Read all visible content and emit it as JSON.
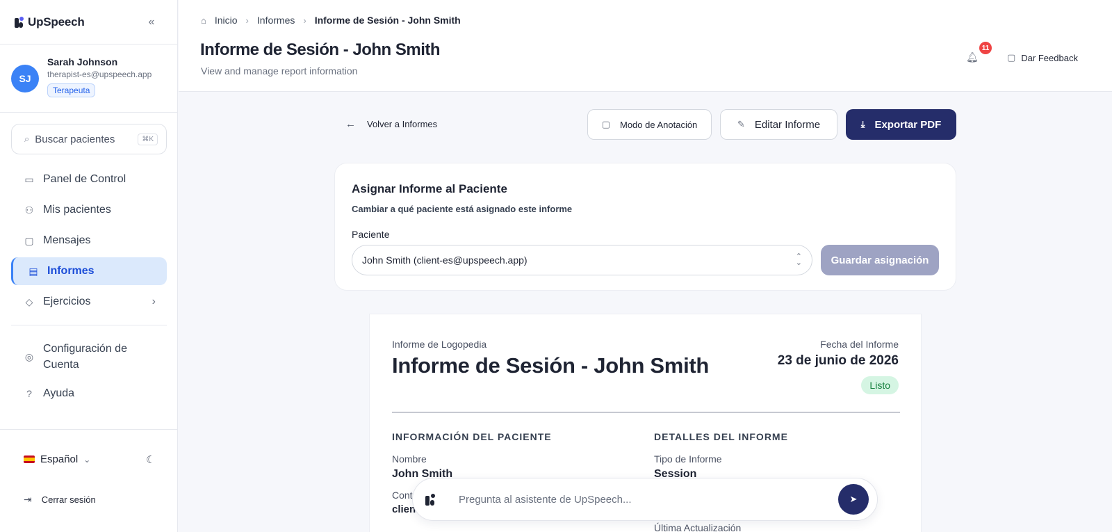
{
  "sidebar": {
    "brand": "UpSpeech",
    "collapse_icon": "«",
    "user": {
      "initials": "SJ",
      "name": "Sarah Johnson",
      "email": "therapist-es@upspeech.app",
      "role": "Terapeuta"
    },
    "search": {
      "placeholder": "Buscar pacientes",
      "shortcut": "⌘K"
    },
    "items": [
      {
        "label": "Panel de Control",
        "icon": "inbox-icon"
      },
      {
        "label": "Mis pacientes",
        "icon": "users-icon"
      },
      {
        "label": "Mensajes",
        "icon": "messages-icon"
      },
      {
        "label": "Informes",
        "icon": "report-icon",
        "active": true
      },
      {
        "label": "Ejercicios",
        "icon": "graduation-cap-icon",
        "has_submenu": true
      }
    ],
    "secondary_items": [
      {
        "label": "Configuración de Cuenta",
        "icon": "user-circle-icon"
      },
      {
        "label": "Ayuda",
        "icon": "help-icon"
      }
    ],
    "language": "Español",
    "logout": "Cerrar sesión"
  },
  "header": {
    "breadcrumbs": [
      "Inicio",
      "Informes",
      "Informe de Sesión - John Smith"
    ],
    "title": "Informe de Sesión - John Smith",
    "subtitle": "View and manage report information",
    "notification_count": "11",
    "feedback_label": "Dar Feedback"
  },
  "actions": {
    "back": "Volver a Informes",
    "annotation": "Modo de Anotación",
    "edit": "Editar Informe",
    "export": "Exportar PDF"
  },
  "assign": {
    "title": "Asignar Informe al Paciente",
    "subtitle": "Cambiar a qué paciente está asignado este informe",
    "field_label": "Paciente",
    "selected_value": "John Smith (client-es@upspeech.app)",
    "save_label": "Guardar asignación"
  },
  "report": {
    "kicker": "Informe de Logopedia",
    "title": "Informe de Sesión - John Smith",
    "date_label": "Fecha del Informe",
    "date": "23 de junio de 2026",
    "status": "Listo",
    "patient_section": {
      "heading": "INFORMACIÓN DEL PACIENTE",
      "name_label": "Nombre",
      "name_value": "John Smith",
      "contact_label": "Cont",
      "contact_value": "clien"
    },
    "details_section": {
      "heading": "DETALLES DEL INFORME",
      "type_label": "Tipo de Informe",
      "type_value": "Session",
      "updated_label": "Última Actualización"
    }
  },
  "chat": {
    "placeholder": "Pregunta al asistente de UpSpeech..."
  },
  "colors": {
    "primary": "#252d6a",
    "accent": "#3b82f6",
    "active_bg": "#dbe9fc",
    "badge": "#ef4444",
    "status_ready": "#d5f5e3"
  }
}
